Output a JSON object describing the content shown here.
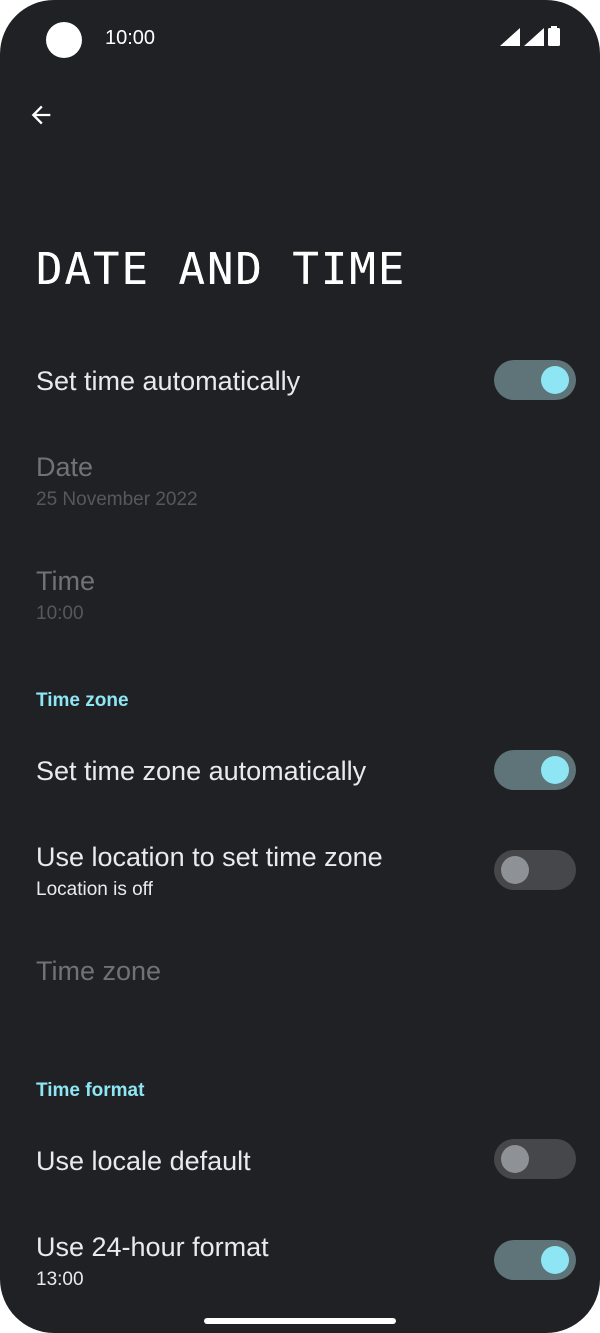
{
  "status_bar": {
    "time": "10:00"
  },
  "page": {
    "title": "DATE AND TIME"
  },
  "settings": {
    "set_time_auto": {
      "title": "Set time automatically",
      "enabled": true
    },
    "date": {
      "title": "Date",
      "summary": "25 November 2022"
    },
    "time": {
      "title": "Time",
      "summary": "10:00"
    },
    "time_zone_header": "Time zone",
    "set_tz_auto": {
      "title": "Set time zone automatically",
      "enabled": true
    },
    "use_location": {
      "title": "Use location to set time zone",
      "summary": "Location is off",
      "enabled": false
    },
    "time_zone": {
      "title": "Time zone"
    },
    "time_format_header": "Time format",
    "locale_default": {
      "title": "Use locale default",
      "enabled": false
    },
    "use_24h": {
      "title": "Use 24-hour format",
      "summary": "13:00",
      "enabled": true
    }
  },
  "colors": {
    "background": "#202124",
    "accent": "#8ee6f5",
    "toggle_on_track": "#5e7479",
    "toggle_off_track": "#45474a"
  },
  "icons": {
    "back": "arrow-left-icon",
    "signal": "cell-signal-icon",
    "battery": "battery-icon"
  }
}
